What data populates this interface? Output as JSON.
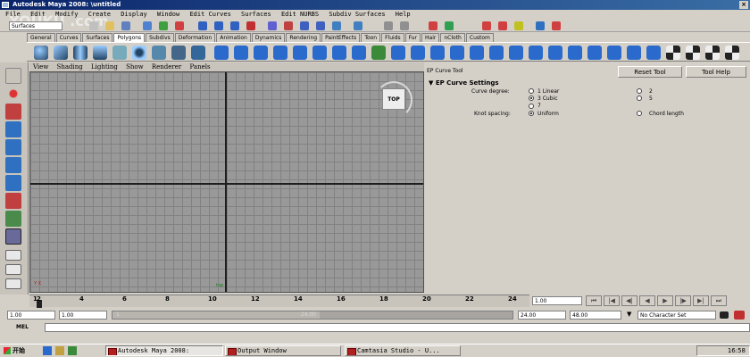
{
  "window": {
    "title": "Autodesk Maya 2008: \\untitled",
    "close_glyph": "×"
  },
  "menu": [
    "File",
    "Edit",
    "Modify",
    "Create",
    "Display",
    "Window",
    "Edit Curves",
    "Surfaces",
    "Edit NURBS",
    "Subdiv Surfaces",
    "Help"
  ],
  "status": {
    "mode": "Surfaces"
  },
  "shelf_tabs": [
    {
      "label": "General"
    },
    {
      "label": "Curves"
    },
    {
      "label": "Surfaces"
    },
    {
      "label": "Polygons",
      "active": true
    },
    {
      "label": "Subdivs"
    },
    {
      "label": "Deformation"
    },
    {
      "label": "Animation"
    },
    {
      "label": "Dynamics"
    },
    {
      "label": "Rendering"
    },
    {
      "label": "PaintEffects"
    },
    {
      "label": "Toon"
    },
    {
      "label": "Fluids"
    },
    {
      "label": "Fur"
    },
    {
      "label": "Hair"
    },
    {
      "label": "nCloth"
    },
    {
      "label": "Custom"
    }
  ],
  "viewport": {
    "menu": [
      "View",
      "Shading",
      "Lighting",
      "Show",
      "Renderer",
      "Panels"
    ],
    "viewcube_label": "TOP",
    "axis_label": "Y X",
    "origin_label": "top"
  },
  "tool_settings": {
    "tool_name": "EP Curve Tool",
    "reset_button": "Reset Tool",
    "help_button": "Tool Help",
    "section_title": "EP Curve Settings",
    "curve_degree_label": "Curve degree:",
    "degree_options": [
      {
        "label": "1 Linear",
        "checked": false
      },
      {
        "label": "2",
        "checked": false
      },
      {
        "label": "3 Cubic",
        "checked": true
      },
      {
        "label": "5",
        "checked": false
      },
      {
        "label": "7",
        "checked": false
      }
    ],
    "knot_spacing_label": "Knot spacing:",
    "knot_options": [
      {
        "label": "Uniform",
        "checked": true
      },
      {
        "label": "Chord length",
        "checked": false
      }
    ]
  },
  "timeline": {
    "ticks": [
      "1",
      "2",
      "4",
      "6",
      "8",
      "10",
      "12",
      "14",
      "16",
      "18",
      "20",
      "22",
      "24"
    ],
    "current_frame": "1.00",
    "start_time": "1.00",
    "playback_start": "1.00",
    "range_left": "1",
    "range_right": "24.00",
    "playback_end": "24.00",
    "end_time": "48.00",
    "character_set": "No Character Set",
    "buttons": [
      "⏮",
      "|◀",
      "◀|",
      "◀",
      "▶",
      "|▶",
      "▶|",
      "⏭"
    ]
  },
  "command_line": {
    "label": "MEL"
  },
  "taskbar": {
    "start": "开始",
    "tasks": [
      {
        "label": "Autodesk Maya 2008:",
        "active": true
      },
      {
        "label": "Output Window",
        "active": false
      },
      {
        "label": "Camtasia Studio - U...",
        "active": false
      }
    ],
    "clock": "16:58"
  },
  "watermark": "YOUKU .com"
}
